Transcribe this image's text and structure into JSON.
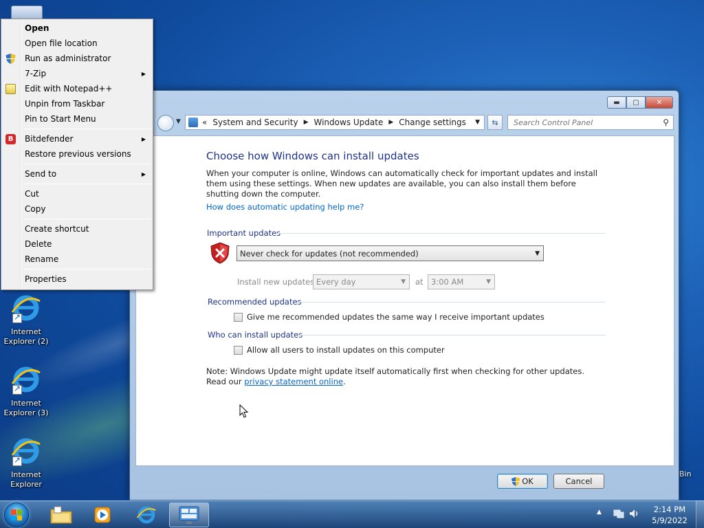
{
  "desktop": {
    "icons": [
      {
        "label_line1": "Internet",
        "label_line2": "Explorer (2)"
      },
      {
        "label_line1": "Internet",
        "label_line2": "Explorer (3)"
      },
      {
        "label_line1": "Internet",
        "label_line2": "Explorer"
      }
    ],
    "bin_label": "Bin"
  },
  "context_menu": {
    "items": [
      {
        "label": "Open"
      },
      {
        "label": "Open file location"
      },
      {
        "label": "Run as administrator",
        "icon": "uac-shield-icon"
      },
      {
        "label": "7-Zip",
        "submenu": true
      },
      {
        "label": "Edit with Notepad++",
        "icon": "notepad-plus-plus-icon"
      },
      {
        "label": "Unpin from Taskbar"
      },
      {
        "label": "Pin to Start Menu"
      },
      {
        "label": "Bitdefender",
        "submenu": true,
        "icon": "bitdefender-icon"
      },
      {
        "label": "Restore previous versions"
      },
      {
        "label": "Send to",
        "submenu": true
      },
      {
        "label": "Cut"
      },
      {
        "label": "Copy"
      },
      {
        "label": "Create shortcut"
      },
      {
        "label": "Delete"
      },
      {
        "label": "Rename"
      },
      {
        "label": "Properties"
      }
    ]
  },
  "window": {
    "controls": {
      "minimize": "▬",
      "maximize": "▢",
      "close": "✕"
    },
    "breadcrumb": {
      "lead": "«",
      "items": [
        "System and Security",
        "Windows Update",
        "Change settings"
      ],
      "separator": "▶"
    },
    "search_placeholder": "Search Control Panel",
    "heading": "Choose how Windows can install updates",
    "description": "When your computer is online, Windows can automatically check for important updates and install them using these settings. When new updates are available, you can also install them before shutting down the computer.",
    "help_link": "How does automatic updating help me?",
    "important_updates": {
      "title": "Important updates",
      "selected": "Never check for updates (not recommended)",
      "install_label": "Install new updates:",
      "frequency": "Every day",
      "at_label": "at",
      "time": "3:00 AM"
    },
    "recommended_updates": {
      "title": "Recommended updates",
      "checkbox_label": "Give me recommended updates the same way I receive important updates"
    },
    "who_can_install": {
      "title": "Who can install updates",
      "checkbox_label": "Allow all users to install updates on this computer"
    },
    "note_text": "Note: Windows Update might update itself automatically first when checking for other updates.  Read our ",
    "note_link": "privacy statement online",
    "note_end": ".",
    "ok_label": "OK",
    "cancel_label": "Cancel"
  },
  "taskbar": {
    "pinned": [
      "windows-explorer-icon",
      "media-player-icon",
      "internet-explorer-icon",
      "control-panel-icon"
    ],
    "clock_time": "2:14 PM",
    "clock_date": "5/9/2022",
    "tray_arrow": "▲"
  },
  "colors": {
    "link": "#0066cc",
    "heading": "#1e3287",
    "desktop": "#1d62b8"
  }
}
